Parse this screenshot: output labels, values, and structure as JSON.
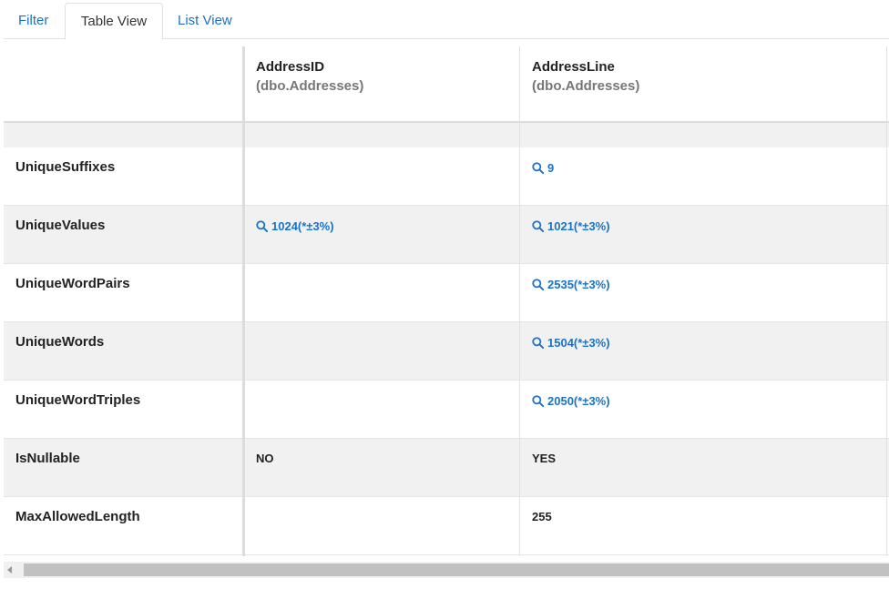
{
  "tabs": [
    {
      "label": "Filter",
      "active": false
    },
    {
      "label": "Table View",
      "active": true
    },
    {
      "label": "List View",
      "active": false
    }
  ],
  "columns": [
    {
      "name": "",
      "source": ""
    },
    {
      "name": "AddressID",
      "source": "(dbo.Addresses)"
    },
    {
      "name": "AddressLine",
      "source": "(dbo.Addresses)"
    }
  ],
  "rows": [
    {
      "label": "UniqueSuffixes",
      "c1": "",
      "c2": "9",
      "c1_link": false,
      "c2_link": true
    },
    {
      "label": "UniqueValues",
      "c1": "1024(*±3%)",
      "c2": "1021(*±3%)",
      "c1_link": true,
      "c2_link": true
    },
    {
      "label": "UniqueWordPairs",
      "c1": "",
      "c2": "2535(*±3%)",
      "c1_link": false,
      "c2_link": true
    },
    {
      "label": "UniqueWords",
      "c1": "",
      "c2": "1504(*±3%)",
      "c1_link": false,
      "c2_link": true
    },
    {
      "label": "UniqueWordTriples",
      "c1": "",
      "c2": "2050(*±3%)",
      "c1_link": false,
      "c2_link": true
    },
    {
      "label": "IsNullable",
      "c1": "NO",
      "c2": "YES",
      "c1_link": false,
      "c2_link": false
    },
    {
      "label": "MaxAllowedLength",
      "c1": "",
      "c2": "255",
      "c1_link": false,
      "c2_link": false
    }
  ],
  "colors": {
    "link": "#1a73c8",
    "row_alt": "#f1f1f1"
  },
  "icons": {
    "link_icon": "search-icon"
  }
}
